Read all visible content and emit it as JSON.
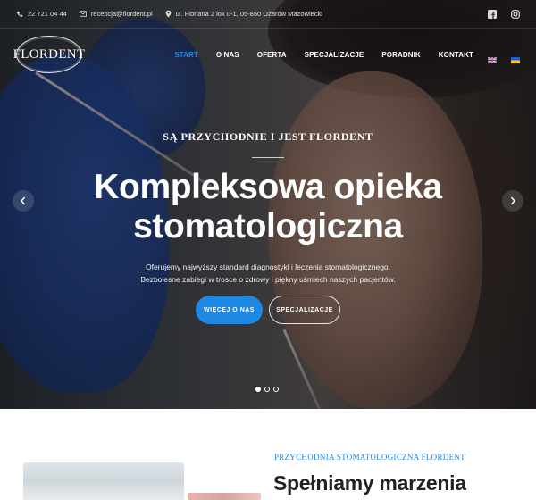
{
  "topbar": {
    "phone": "22 721 04 44",
    "email": "recepcja@flordent.pl",
    "address": "ul. Floriana 2 lok u-1, 05-850 Ożarów Mazowiecki",
    "icons": [
      "phone-icon",
      "mail-icon",
      "map-pin-icon",
      "facebook-icon",
      "instagram-icon"
    ]
  },
  "nav": {
    "logo_text": "FLORDENT",
    "items": [
      "START",
      "O NAS",
      "OFERTA",
      "SPECJALIZACJE",
      "PORADNIK",
      "KONTAKT"
    ],
    "active_index": 0,
    "languages": [
      "en-flag",
      "ua-flag"
    ]
  },
  "hero": {
    "kicker": "SĄ PRZYCHODNIE I JEST FLORDENT",
    "title_line1": "Kompleksowa opieka",
    "title_line2": "stomatologiczna",
    "sub_line1": "Oferujemy najwyższy standard diagnostyki i leczenia stomatologicznego.",
    "sub_line2": "Bezbolesne zabiegi w trosce o zdrowy i piękny uśmiech naszych pacjentów.",
    "button_primary": "WIĘCEJ O NAS",
    "button_secondary": "SPECJALIZACJE",
    "slide_count": 3,
    "active_slide": 0
  },
  "section": {
    "kicker": "PRZYCHODNIA STOMATOLOGICZNA FLORDENT",
    "title": "Spełniamy marzenia"
  },
  "colors": {
    "accent": "#1e88e5",
    "hero_text": "#ffffff",
    "heading": "#222222"
  }
}
